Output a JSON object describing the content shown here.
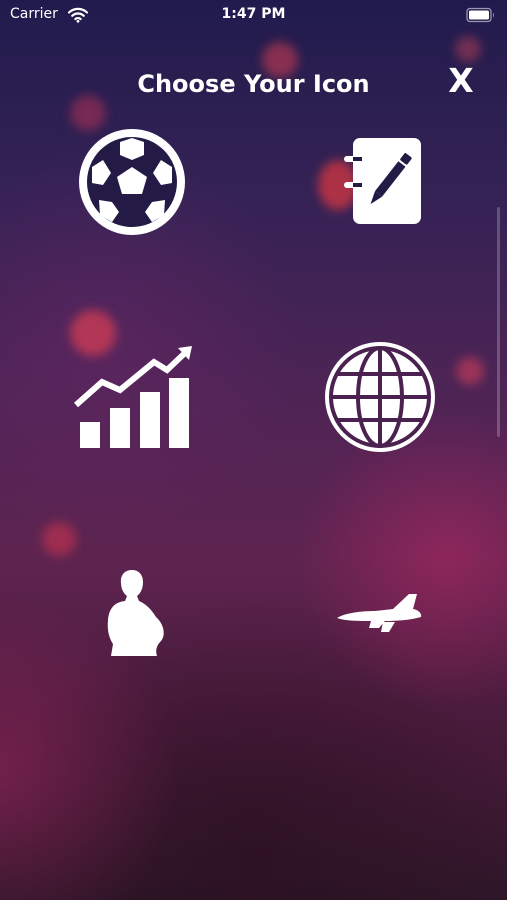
{
  "status_bar": {
    "carrier": "Carrier",
    "time": "1:47 PM",
    "icons": [
      "wifi-icon",
      "battery-icon"
    ]
  },
  "header": {
    "title": "Choose Your Icon",
    "close_label": "X"
  },
  "icon_grid": {
    "options": [
      {
        "icon": "soccer-ball-icon"
      },
      {
        "icon": "notebook-pen-icon"
      },
      {
        "icon": "growth-chart-icon"
      },
      {
        "icon": "globe-icon"
      },
      {
        "icon": "person-silhouette-icon"
      },
      {
        "icon": "jet-plane-icon"
      },
      {
        "icon": "partial-icon"
      },
      {
        "icon": "partial-icon"
      }
    ]
  },
  "colors": {
    "icon": "#ffffff",
    "text": "#ffffff",
    "background_top": "#211b4d",
    "background_bottom": "#2e1628",
    "accent_pink": "#ff4a5a"
  }
}
